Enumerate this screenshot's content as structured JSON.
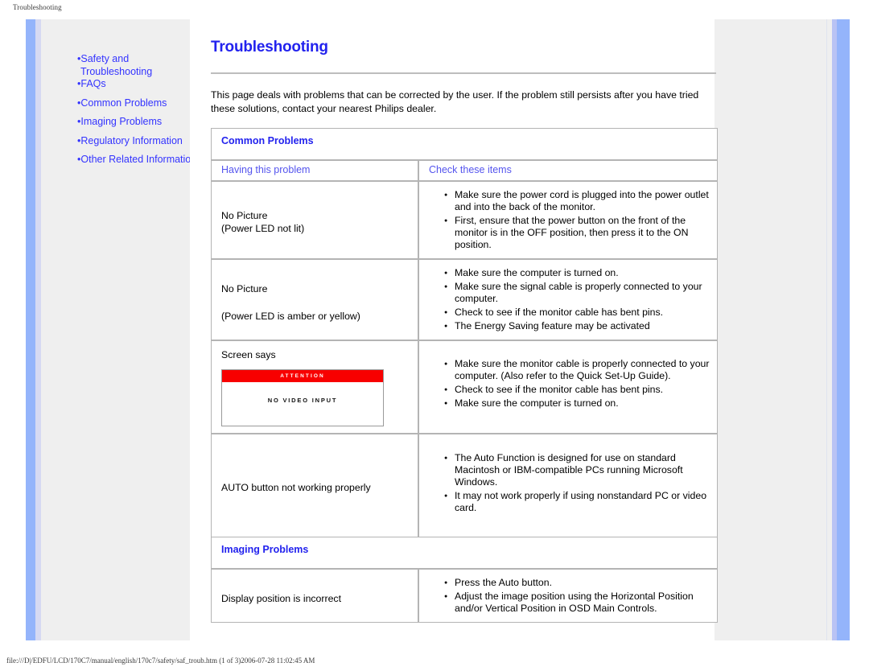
{
  "browser": {
    "print_header": "Troubleshooting",
    "status_url": "file:///D|/EDFU/LCD/170C7/manual/english/170c7/safety/saf_troub.htm (1 of 3)2006-07-28 11:02:45 AM"
  },
  "colors": {
    "link_blue": "#3333ff",
    "heading_blue": "#2222ee",
    "column_header_blue": "#5555ee",
    "sidebar_bg": "#efefef",
    "gutter_blue": "#94b4fb",
    "attention_red": "#f80000",
    "table_border": "#b4b4b4"
  },
  "sidebar": {
    "items": [
      {
        "bullet": "•",
        "label": "Safety and",
        "continuation": "Troubleshooting"
      },
      {
        "bullet": "•",
        "label": "FAQs"
      },
      {
        "bullet": "•",
        "label": "Common Problems"
      },
      {
        "bullet": "•",
        "label": "Imaging Problems"
      },
      {
        "bullet": "•",
        "label": "Regulatory Information"
      },
      {
        "bullet": "•",
        "label": "Other Related Information"
      }
    ]
  },
  "main": {
    "title": "Troubleshooting",
    "intro": "This page deals with problems that can be corrected by the user. If the problem still persists after you have tried these solutions, contact your nearest Philips dealer.",
    "sections": [
      {
        "heading": "Common Problems",
        "col_headers": {
          "problem": "Having this problem",
          "checks": "Check these items"
        },
        "rows": [
          {
            "problem_lines": [
              "No Picture",
              "(Power LED not lit)"
            ],
            "checks": [
              "Make sure the power cord is plugged into the power outlet and into the back of the monitor.",
              "First, ensure that the power button on the front of the monitor is in the OFF position, then press it to the ON position."
            ]
          },
          {
            "problem_lines": [
              "No Picture",
              "",
              "(Power LED is amber or yellow)"
            ],
            "checks": [
              "Make sure the computer is turned on.",
              "Make sure the signal cable is properly connected to your computer.",
              "Check to see if the monitor cable has bent pins.",
              "The Energy Saving feature may be activated"
            ]
          },
          {
            "problem_lines": [
              "Screen says"
            ],
            "osd": {
              "title": "ATTENTION",
              "message": "NO VIDEO INPUT"
            },
            "checks": [
              "Make sure the monitor cable is properly connected to your computer. (Also refer to the Quick Set-Up Guide).",
              "Check to see if the monitor cable has bent pins.",
              "Make sure the computer is turned on."
            ]
          },
          {
            "problem_lines": [
              "AUTO button not working properly"
            ],
            "checks": [
              "The Auto Function is designed for use on standard Macintosh or IBM-compatible PCs running Microsoft Windows.",
              "It may not work properly if using nonstandard PC or video card."
            ]
          }
        ]
      },
      {
        "heading": "Imaging Problems",
        "rows": [
          {
            "problem_lines": [
              "Display position is incorrect"
            ],
            "checks": [
              "Press the Auto button.",
              "Adjust the image position using the Horizontal Position and/or Vertical Position in OSD Main Controls."
            ]
          }
        ]
      }
    ]
  }
}
